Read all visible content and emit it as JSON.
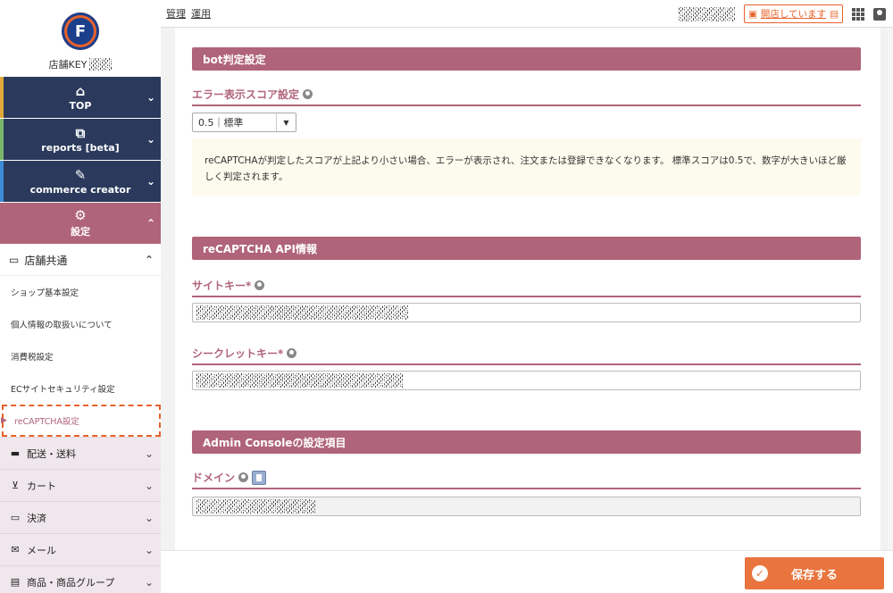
{
  "sidebar": {
    "logo_letter": "F",
    "store_key_label": "店舗KEY",
    "main_nav": [
      {
        "label": "TOP",
        "icon": "home-icon",
        "bar_color": "#e0a93a"
      },
      {
        "label": "reports [beta]",
        "icon": "chart-icon",
        "bar_color": "#7bb56a"
      },
      {
        "label": "commerce creator",
        "icon": "wrench-icon",
        "bar_color": "#3d8ad6"
      },
      {
        "label": "設定",
        "icon": "gear-icon",
        "bar_color": "#b06479"
      }
    ],
    "sub_head": "店舗共通",
    "sub_items": [
      "ショップ基本設定",
      "個人情報の取扱いについて",
      "消費税設定",
      "ECサイトセキュリティ設定",
      "reCAPTCHA設定"
    ],
    "categories": [
      {
        "label": "配送・送料",
        "icon": "truck-icon"
      },
      {
        "label": "カート",
        "icon": "cart-icon"
      },
      {
        "label": "決済",
        "icon": "card-icon"
      },
      {
        "label": "メール",
        "icon": "mail-icon"
      },
      {
        "label": "商品・商品グループ",
        "icon": "product-icon"
      }
    ]
  },
  "topbar": {
    "tabs": [
      "管理",
      "運用"
    ],
    "open_status": "開店しています"
  },
  "main": {
    "bot_section": "bot判定設定",
    "score_label": "エラー表示スコア設定",
    "score_value": "0.5｜標準",
    "notice": "reCAPTCHAが判定したスコアが上記より小さい場合、エラーが表示され、注文または登録できなくなります。 標準スコアは0.5で、数字が大きいほど厳しく判定されます。",
    "api_section": "reCAPTCHA API情報",
    "site_key_label": "サイトキー*",
    "secret_key_label": "シークレットキー*",
    "admin_section": "Admin Consoleの設定項目",
    "domain_label": "ドメイン"
  },
  "footer": {
    "save_label": "保存する"
  },
  "colors": {
    "accent": "#b06479",
    "nav": "#2b3a5c",
    "save": "#e9743d"
  }
}
